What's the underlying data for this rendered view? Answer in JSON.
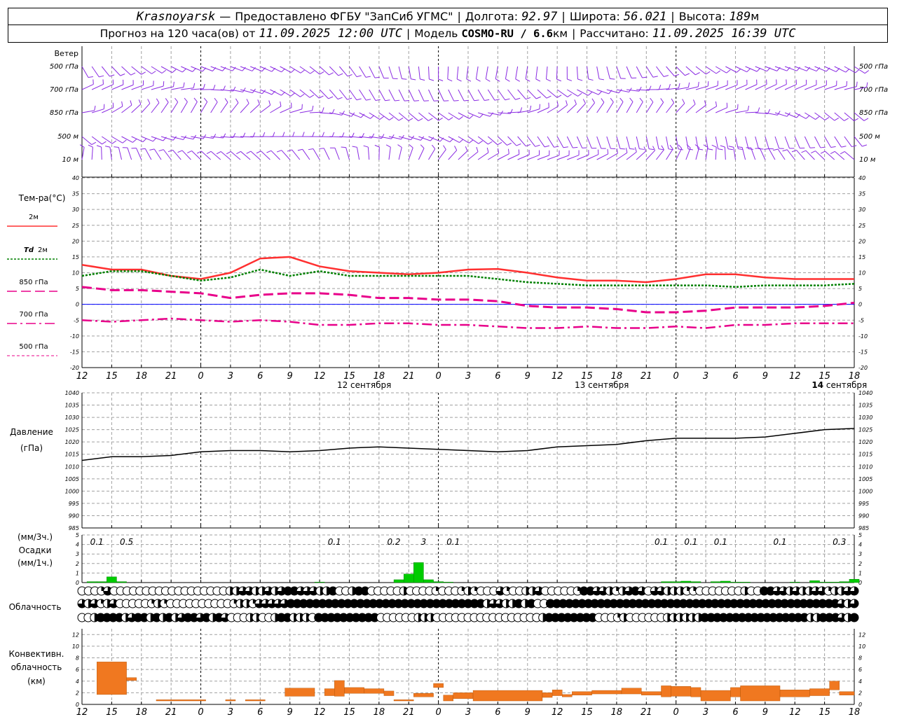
{
  "header": {
    "city": "Krasnoyarsk",
    "dash": "—",
    "provider": "Предоставлено ФГБУ \"ЗапСиб УГМС\"",
    "lon_label": "Долгота:",
    "lon": "92.97",
    "lat_label": "Широта:",
    "lat": "56.021",
    "alt_label": "Высота:",
    "alt": "189",
    "alt_unit": "м",
    "fc_label": "Прогноз на 120 часа(ов) от",
    "fc_time": "11.09.2025 12:00 UTC",
    "model_label": "Модель",
    "model": "COSMO-RU / 6.6",
    "model_unit": "км",
    "calc_label": "Рассчитано:",
    "calc_time": "11.09.2025 16:39 UTC"
  },
  "colors": {
    "wind": "#8a2be2",
    "t2m": "#ff3030",
    "td2m": "#008000",
    "t850": "#e8008a",
    "t700": "#e8008a",
    "t500": "#e8008a",
    "zero": "#0000ff",
    "pressure": "#000000",
    "precip": "#00cc00",
    "convective": "#f07820",
    "grid": "#a0a0a0"
  },
  "chart_data": [
    {
      "type": "wind-barbs",
      "title": "Ветер",
      "levels": [
        "500 гПа",
        "700 гПа",
        "850 гПа",
        "500 м",
        "10 м"
      ]
    },
    {
      "type": "line",
      "title": "Тем-ра(°C)",
      "ylim": [
        -20,
        40
      ],
      "yticks": [
        -20,
        -15,
        -10,
        -5,
        0,
        5,
        10,
        15,
        20,
        25,
        30,
        35,
        40
      ],
      "x_hours": [
        0,
        3,
        6,
        9,
        12,
        15,
        18,
        21,
        24,
        27,
        30,
        33,
        36,
        39,
        42,
        45,
        48,
        51,
        54,
        57,
        60,
        63,
        66,
        69,
        72,
        75,
        78
      ],
      "series": [
        {
          "name": "2м",
          "key": "t2m",
          "values": [
            12.5,
            11,
            11,
            9,
            8,
            10,
            14.5,
            15,
            12,
            10.5,
            10,
            9.5,
            10,
            11,
            11.2,
            10,
            8.5,
            7.5,
            7.5,
            7,
            8,
            9.5,
            9.5,
            8.5,
            8,
            8,
            8
          ]
        },
        {
          "name": "Td 2м",
          "key": "td2m",
          "values": [
            9,
            10.5,
            10.5,
            9,
            7.5,
            8.5,
            11,
            9,
            10.5,
            9,
            9,
            9,
            9,
            9,
            8,
            7,
            6.5,
            6,
            6,
            6,
            6,
            6,
            5.5,
            6,
            6,
            6,
            6.5
          ]
        },
        {
          "name": "850 гПа",
          "key": "t850",
          "values": [
            5.5,
            4.5,
            4.5,
            4,
            3.5,
            2,
            3,
            3.5,
            3.5,
            3,
            2,
            2,
            1.5,
            1.5,
            1,
            -0.5,
            -1,
            -1,
            -1.5,
            -2.5,
            -2.5,
            -2,
            -1,
            -1,
            -1,
            -0.5,
            0.5
          ]
        },
        {
          "name": "700 гПа",
          "key": "t700",
          "values": [
            -5,
            -5.5,
            -5,
            -4.5,
            -5,
            -5.5,
            -5,
            -5.5,
            -6.5,
            -6.5,
            -6,
            -6,
            -6.5,
            -6.5,
            -7,
            -7.5,
            -7.5,
            -7,
            -7.5,
            -7.5,
            -7,
            -7.5,
            -6.5,
            -6.5,
            -6,
            -6,
            -6
          ]
        },
        {
          "name": "500 гПа",
          "key": "t500",
          "values": []
        }
      ]
    },
    {
      "type": "line",
      "title": "Давление",
      "ylabel": "(гПа)",
      "ylim": [
        985,
        1040
      ],
      "yticks": [
        985,
        990,
        995,
        1000,
        1005,
        1010,
        1015,
        1020,
        1025,
        1030,
        1035,
        1040
      ],
      "x_hours": [
        0,
        3,
        6,
        9,
        12,
        15,
        18,
        21,
        24,
        27,
        30,
        33,
        36,
        39,
        42,
        45,
        48,
        51,
        54,
        57,
        60,
        63,
        66,
        69,
        72,
        75,
        78
      ],
      "values": [
        1012.5,
        1014,
        1014,
        1014.5,
        1016,
        1016.5,
        1016.5,
        1016,
        1016.5,
        1017.5,
        1018,
        1017.5,
        1017,
        1016.5,
        1016,
        1016.5,
        1018,
        1018.5,
        1019,
        1020.5,
        1021.5,
        1021.5,
        1021.5,
        1022,
        1023.5,
        1025,
        1025.5
      ]
    },
    {
      "type": "bar",
      "title": "Осадки",
      "ylabel_3h": "(мм/3ч.)",
      "ylabel_1h": "(мм/1ч.)",
      "ylim": [
        0,
        5
      ],
      "yticks": [
        0,
        1,
        2,
        3,
        4,
        5
      ],
      "hourly_x": [
        1,
        2,
        3,
        4,
        24,
        32,
        33,
        34,
        35,
        36,
        37,
        59,
        60,
        61,
        62,
        64,
        65,
        66,
        67,
        72,
        74,
        75,
        76,
        77,
        78
      ],
      "hourly_values": [
        0.1,
        0.1,
        0.6,
        0.1,
        0.05,
        0.3,
        0.9,
        2.1,
        0.3,
        0.1,
        0.05,
        0.1,
        0.1,
        0.15,
        0.1,
        0.1,
        0.15,
        0.05,
        0.05,
        0.05,
        0.2,
        0.05,
        0.05,
        0.1,
        0.35
      ],
      "totals_3h_x": [
        1.5,
        4.5,
        25.5,
        31.5,
        34.5,
        37.5,
        58.5,
        61.5,
        64.5,
        70.5,
        76.5
      ],
      "totals_3h": [
        "0.1",
        "0.5",
        "0.1",
        "0.2",
        "3",
        "0.1",
        "0.1",
        "0.1",
        "0.1",
        "0.1",
        "0.3"
      ]
    },
    {
      "type": "table",
      "title": "Облачность",
      "legend": "circle fill = cloud cover fraction (0–1), rows = high / middle / low",
      "rows": [
        [
          0,
          0,
          0,
          0.25,
          0.75,
          0,
          0,
          0,
          0,
          0,
          0,
          0,
          0,
          0,
          0,
          0,
          0,
          0,
          0,
          0,
          0,
          0,
          0,
          0.5,
          0.5,
          0.75,
          0.75,
          0.5,
          0.5,
          0.75,
          0.5,
          0.75,
          1,
          1,
          0.75,
          0.75,
          0.75,
          0.5,
          0.5,
          1,
          0,
          0,
          0.5,
          1,
          1,
          0,
          0,
          0,
          0,
          0,
          0.5,
          0,
          0,
          0,
          0,
          0.25,
          0,
          0,
          0,
          0.25,
          0.5,
          0.25,
          0,
          0,
          0,
          0.75,
          0.25,
          0,
          0,
          0.5,
          0.5,
          0.75,
          0,
          0,
          0,
          0,
          0,
          0.25,
          1,
          1,
          0.75,
          0.75,
          0.5,
          0.25,
          0.5,
          0.75,
          1,
          0.75,
          0,
          0.75,
          0.75,
          0.5,
          0.5,
          0.5,
          0.25,
          0.25,
          0,
          0,
          0,
          0,
          0,
          0,
          0,
          0.5,
          0,
          0,
          1,
          1,
          0.75,
          0.75,
          0.5,
          0.75,
          0.5,
          0.5,
          0.75,
          0.75,
          0.25,
          0.5,
          0.5,
          0.75,
          0.75
        ],
        [
          0.75,
          0.5,
          0.75,
          0.25,
          0.5,
          0.75,
          0,
          0,
          0,
          0,
          0,
          0.25,
          0.5,
          0.25,
          0,
          0,
          0,
          0,
          0,
          0,
          0,
          0,
          0,
          0,
          0.25,
          0.5,
          0.5,
          0.25,
          0.75,
          0.75,
          0.75,
          0.75,
          0.75,
          1,
          1,
          1,
          1,
          1,
          1,
          1,
          1,
          1,
          1,
          1,
          1,
          1,
          1,
          1,
          1,
          1,
          1,
          1,
          1,
          1,
          1,
          1,
          1,
          1,
          1,
          1,
          1,
          1,
          1,
          1,
          0.5,
          0.75,
          0.75,
          0.5,
          0.5,
          1,
          0.5,
          1,
          0,
          0,
          1,
          1,
          1,
          1,
          1,
          1,
          1,
          1,
          1,
          1,
          1,
          1,
          1,
          1,
          1,
          1,
          1,
          1,
          1,
          1,
          1,
          1,
          1,
          1,
          1,
          1,
          1,
          1,
          1,
          1,
          1,
          1,
          1,
          1,
          1,
          1,
          1,
          1,
          1,
          1,
          1,
          1,
          1,
          1,
          1,
          1,
          0.75,
          0.5,
          0.75
        ],
        [
          0,
          0,
          0.5,
          1,
          1,
          1,
          1,
          0.5,
          0.75,
          1,
          1,
          0.5,
          1,
          0.5,
          1,
          0.5,
          0.75,
          1,
          1,
          0.75,
          1,
          0.5,
          1,
          0.75,
          0,
          0,
          0,
          0.5,
          0.5,
          0,
          0,
          0.5,
          1,
          1,
          0.5,
          0.5,
          0.5,
          0,
          1,
          1,
          1,
          1,
          1,
          1,
          1,
          1,
          1,
          1,
          0,
          0,
          0,
          0,
          0,
          0,
          0.5,
          0.5,
          0.5,
          0,
          0,
          0,
          0,
          0,
          0,
          0,
          0,
          0,
          0,
          0,
          0,
          0,
          0,
          0,
          0,
          0,
          0.5,
          1,
          1,
          1,
          1,
          1,
          1,
          1,
          1,
          0,
          0,
          0,
          0.25,
          0.5,
          0,
          0,
          0,
          0,
          0,
          0,
          0.5,
          0.5,
          0.5,
          0.5,
          0.5,
          0.5,
          1,
          1,
          1,
          1,
          1,
          1,
          1,
          1,
          1,
          1,
          1,
          1,
          1,
          1,
          1,
          1,
          1,
          0.5,
          0.5,
          1,
          1,
          1,
          0.75,
          0.5,
          1
        ]
      ]
    },
    {
      "type": "bar",
      "title": "Конвективн.\nоблачность",
      "ylabel": "(км)",
      "ylim": [
        0,
        13
      ],
      "yticks": [
        0,
        2,
        4,
        6,
        8,
        10,
        12
      ],
      "layers": [
        {
          "x0": 1.5,
          "x1": 4.5,
          "bottom": 1.7,
          "top": 7.3
        },
        {
          "x0": 4.5,
          "x1": 5.5,
          "bottom": 4.1,
          "top": 4.6
        },
        {
          "x0": 7.5,
          "x1": 12.5,
          "bottom": 0.6,
          "top": 0.8
        },
        {
          "x0": 14.5,
          "x1": 15.5,
          "bottom": 0.6,
          "top": 0.8
        },
        {
          "x0": 16.5,
          "x1": 18.5,
          "bottom": 0.6,
          "top": 0.8
        },
        {
          "x0": 20.5,
          "x1": 23.5,
          "bottom": 1.4,
          "top": 2.8
        },
        {
          "x0": 24.5,
          "x1": 25.5,
          "bottom": 1.5,
          "top": 2.7
        },
        {
          "x0": 25.5,
          "x1": 26.5,
          "bottom": 1.4,
          "top": 4.1
        },
        {
          "x0": 26.5,
          "x1": 28.5,
          "bottom": 1.9,
          "top": 2.9
        },
        {
          "x0": 28.5,
          "x1": 30.5,
          "bottom": 1.9,
          "top": 2.7
        },
        {
          "x0": 30.5,
          "x1": 31.5,
          "bottom": 1.5,
          "top": 2.3
        },
        {
          "x0": 31.5,
          "x1": 33.5,
          "bottom": 0.6,
          "top": 0.8
        },
        {
          "x0": 33.5,
          "x1": 35.5,
          "bottom": 1.3,
          "top": 1.9
        },
        {
          "x0": 35.5,
          "x1": 36.5,
          "bottom": 2.9,
          "top": 3.6
        },
        {
          "x0": 36.5,
          "x1": 37.5,
          "bottom": 0.6,
          "top": 1.6
        },
        {
          "x0": 37.5,
          "x1": 39.5,
          "bottom": 1.0,
          "top": 2.0
        },
        {
          "x0": 39.5,
          "x1": 46.5,
          "bottom": 0.6,
          "top": 2.4
        },
        {
          "x0": 46.5,
          "x1": 47.5,
          "bottom": 1.2,
          "top": 2.0
        },
        {
          "x0": 47.5,
          "x1": 48.5,
          "bottom": 1.5,
          "top": 2.5
        },
        {
          "x0": 48.5,
          "x1": 49.5,
          "bottom": 1.3,
          "top": 1.7
        },
        {
          "x0": 49.5,
          "x1": 51.5,
          "bottom": 1.6,
          "top": 2.2
        },
        {
          "x0": 51.5,
          "x1": 54.5,
          "bottom": 1.8,
          "top": 2.4
        },
        {
          "x0": 54.5,
          "x1": 56.5,
          "bottom": 1.8,
          "top": 2.8
        },
        {
          "x0": 56.5,
          "x1": 58.5,
          "bottom": 1.6,
          "top": 2.2
        },
        {
          "x0": 58.5,
          "x1": 59.5,
          "bottom": 1.3,
          "top": 3.2
        },
        {
          "x0": 59.5,
          "x1": 61.5,
          "bottom": 1.4,
          "top": 3.1
        },
        {
          "x0": 61.5,
          "x1": 62.5,
          "bottom": 1.3,
          "top": 2.9
        },
        {
          "x0": 62.5,
          "x1": 65.5,
          "bottom": 0.6,
          "top": 2.4
        },
        {
          "x0": 65.5,
          "x1": 66.5,
          "bottom": 1.3,
          "top": 2.9
        },
        {
          "x0": 66.5,
          "x1": 70.5,
          "bottom": 0.6,
          "top": 3.2
        },
        {
          "x0": 70.5,
          "x1": 73.5,
          "bottom": 1.3,
          "top": 2.5
        },
        {
          "x0": 73.5,
          "x1": 75.5,
          "bottom": 1.5,
          "top": 2.7
        },
        {
          "x0": 75.5,
          "x1": 76.5,
          "bottom": 2.5,
          "top": 4.0
        },
        {
          "x0": 76.5,
          "x1": 78,
          "bottom": 1.6,
          "top": 2.2
        }
      ]
    }
  ],
  "axis": {
    "tick_hours": [
      "12",
      "15",
      "18",
      "21",
      "0",
      "3",
      "6",
      "9",
      "12",
      "15",
      "18",
      "21",
      "0",
      "3",
      "6",
      "9",
      "12",
      "15",
      "18",
      "21",
      "0",
      "3",
      "6",
      "9",
      "12",
      "15",
      "18"
    ],
    "day_labels": [
      {
        "num": "12",
        "name": " сентября",
        "bold": false,
        "x_hour": 28.5
      },
      {
        "num": "13",
        "name": " сентября",
        "bold": false,
        "x_hour": 52.5
      },
      {
        "num": "14",
        "name": " сентября",
        "bold": true,
        "x_hour": 76.5
      }
    ]
  }
}
